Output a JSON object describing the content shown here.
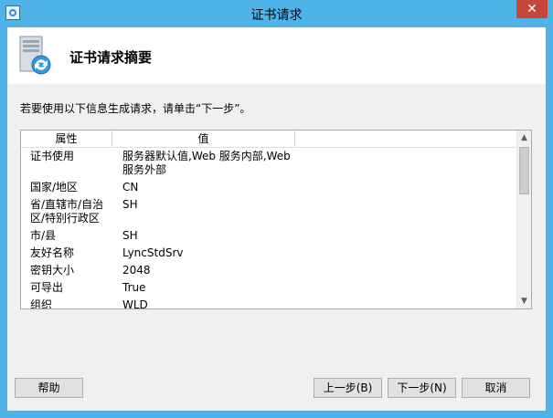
{
  "window": {
    "title": "证书请求",
    "close_label": "✕"
  },
  "header": {
    "title": "证书请求摘要"
  },
  "instruction": "若要使用以下信息生成请求，请单击“下一步”。",
  "table": {
    "columns": [
      "属性",
      "值"
    ],
    "rows": [
      {
        "attr": "证书使用",
        "value": "服务器默认值,Web 服务内部,Web 服务外部"
      },
      {
        "attr": "国家/地区",
        "value": "CN"
      },
      {
        "attr": "省/直辖市/自治区/特别行政区",
        "value": "SH"
      },
      {
        "attr": "市/县",
        "value": "SH"
      },
      {
        "attr": "友好名称",
        "value": "LyncStdSrv"
      },
      {
        "attr": "密钥大小",
        "value": "2048"
      },
      {
        "attr": "可导出",
        "value": "True"
      },
      {
        "attr": "组织",
        "value": "WLD"
      }
    ]
  },
  "buttons": {
    "help": "帮助",
    "back": "上一步(B)",
    "next": "下一步(N)",
    "cancel": "取消"
  },
  "icons": {
    "app": "certificate-window-icon",
    "header": "server-certificate-icon",
    "scroll_up": "chevron-up-icon",
    "scroll_down": "chevron-down-icon"
  }
}
